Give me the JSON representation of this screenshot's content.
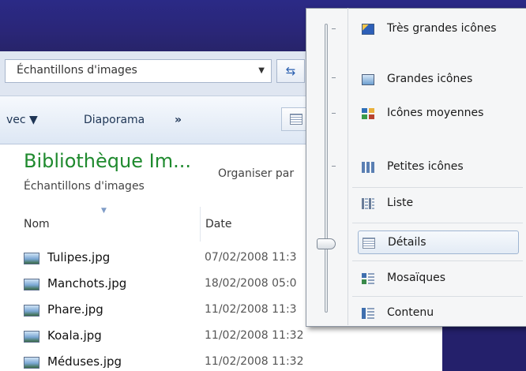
{
  "explorer": {
    "address": {
      "text": "Échantillons d'images",
      "dropdown_icon": "chevron-down-icon",
      "refresh_icon": "refresh-icon"
    },
    "toolbar": {
      "open_with_label": "vec ▼",
      "slideshow_label": "Diaporama",
      "overflow_label": "»"
    },
    "library": {
      "title": "Bibliothèque Im...",
      "subtitle": "Échantillons d'images",
      "arrange_label": "Organiser par"
    },
    "columns": {
      "name": "Nom",
      "date": "Date"
    },
    "files": [
      {
        "name": "Tulipes.jpg",
        "date": "07/02/2008 11:3"
      },
      {
        "name": "Manchots.jpg",
        "date": "18/02/2008 05:0"
      },
      {
        "name": "Phare.jpg",
        "date": "11/02/2008 11:3"
      },
      {
        "name": "Koala.jpg",
        "date": "11/02/2008 11:32"
      },
      {
        "name": "Méduses.jpg",
        "date": "11/02/2008 11:32"
      }
    ]
  },
  "view_menu": {
    "items": [
      {
        "label": "Très grandes icônes",
        "icon": "extra-large-icons-icon",
        "selected": false
      },
      {
        "label": "Grandes icônes",
        "icon": "large-icons-icon",
        "selected": false
      },
      {
        "label": "Icônes moyennes",
        "icon": "medium-icons-icon",
        "selected": false
      },
      {
        "label": "Petites icônes",
        "icon": "small-icons-icon",
        "selected": false
      },
      {
        "label": "Liste",
        "icon": "list-icon",
        "selected": false
      },
      {
        "label": "Détails",
        "icon": "details-icon",
        "selected": true
      },
      {
        "label": "Mosaïques",
        "icon": "tiles-icon",
        "selected": false
      },
      {
        "label": "Contenu",
        "icon": "content-icon",
        "selected": false
      }
    ]
  }
}
